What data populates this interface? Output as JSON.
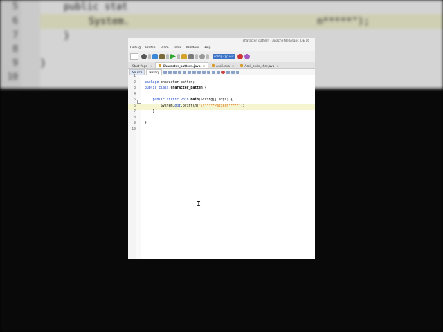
{
  "background": {
    "line_numbers": [
      "5",
      "6",
      "7",
      "8",
      "9",
      "10"
    ],
    "code_lines": [
      "public stat",
      "System.",
      "}",
      "",
      "}",
      ""
    ],
    "code_tail": "n*****\");"
  },
  "window_title": "character_pattern - Apache NetBeans IDE 16",
  "menu": [
    "Debug",
    "Profile",
    "Team",
    "Tools",
    "Window",
    "Help"
  ],
  "toolbar": {
    "highlight_label": "config.cpp.out"
  },
  "tabs": [
    {
      "label": "Start Page",
      "active": false
    },
    {
      "label": "Character_pattern.java",
      "active": true
    },
    {
      "label": "Ascii.java",
      "active": false
    },
    {
      "label": "Ascii_code_char.java",
      "active": false
    }
  ],
  "subtabs": {
    "source": "Source",
    "history": "History"
  },
  "editor": {
    "lines": [
      {
        "num": "1",
        "code": ""
      },
      {
        "num": "2",
        "code": "package character_patten;"
      },
      {
        "num": "3",
        "code": "public class Character_patten {"
      },
      {
        "num": "4",
        "code": ""
      },
      {
        "num": "5",
        "code": "    public static void main(String[] args) {"
      },
      {
        "num": "6",
        "code": "        System.out.println(\"\\t*****Pattern*****\");"
      },
      {
        "num": "7",
        "code": "    }"
      },
      {
        "num": "8",
        "code": ""
      },
      {
        "num": "9",
        "code": "}"
      },
      {
        "num": "10",
        "code": ""
      }
    ]
  },
  "colors": {
    "keyword": "#0a38c6",
    "string": "#d96a00",
    "current_line": "#f5f5d2"
  }
}
